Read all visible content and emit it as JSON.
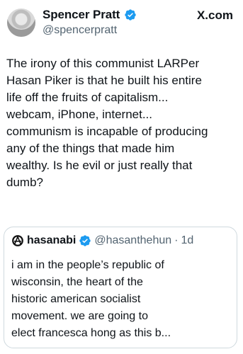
{
  "tweet": {
    "author_name": "Spencer Pratt",
    "author_handle": "@spencerpratt",
    "brand": "X.com",
    "text": "The irony of this communist LARPer\nHasan Piker is that he built his entire\nlife off the fruits of capitalism...\nwebcam, iPhone, internet...\ncommunism is incapable of producing\nany of the things that made him\nwealthy. Is he evil or just really that\ndumb?"
  },
  "quote": {
    "author_name": "hasanabi",
    "author_handle": "@hasanthehun",
    "separator": "·",
    "time": "1d",
    "text": "i am in the people’s republic of\nwisconsin, the heart of the\nhistoric american socialist\nmovement. we are going to\nelect francesca hong as this b..."
  },
  "icons": {
    "verified": "verified-badge-icon",
    "quote_avatar": "anarchist-symbol-icon"
  },
  "colors": {
    "verified": "#1d9bf0",
    "text": "#0f1419",
    "secondary": "#536471",
    "border": "#cfd9de"
  }
}
